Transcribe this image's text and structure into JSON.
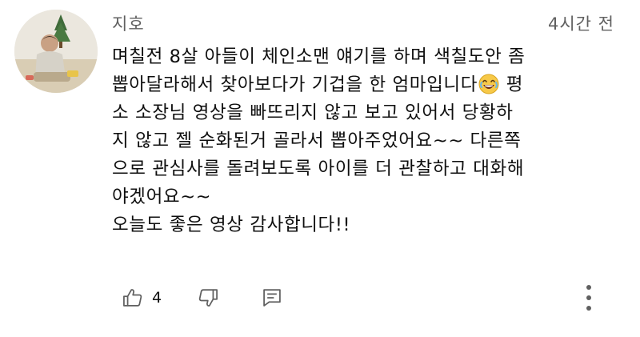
{
  "comment": {
    "author": "지호",
    "timestamp": "4시간 전",
    "text_before_emoji": "며칠전 8살 아들이 체인소맨 얘기를 하며 색칠도안 좀\n뽑아달라해서 찾아보다가 기겁을 한 엄마입니다",
    "emoji": "laughing-face",
    "text_after_emoji": " 평\n소 소장님 영상을 빠뜨리지 않고 보고 있어서 당황하\n지 않고 젤 순화된거 골라서 뽑아주었어요~~ 다른쪽\n으로 관심사를 돌려보도록 아이를 더 관찰하고 대화해\n야겠어요~~\n오늘도 좋은 영상 감사합니다!!",
    "like_count": "4"
  },
  "icons": {
    "like": "thumbs-up-icon",
    "dislike": "thumbs-down-icon",
    "reply": "reply-icon",
    "more": "more-vertical-icon"
  },
  "colors": {
    "text": "#0f0f0f",
    "meta": "#606060",
    "icon": "#606060"
  }
}
